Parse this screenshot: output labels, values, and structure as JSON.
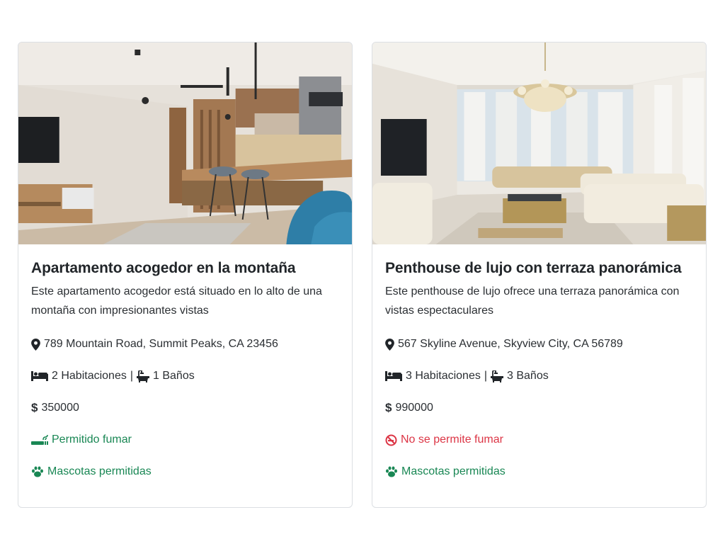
{
  "listings": [
    {
      "title": "Apartamento acogedor en la montaña",
      "description": "Este apartamento acogedor está situado en lo alto de una montaña con impresionantes vistas",
      "address": "789 Mountain Road, Summit Peaks, CA 23456",
      "bedrooms": "2 Habitaciones",
      "separator": "|",
      "bathrooms": "1 Baños",
      "price": "350000",
      "smoking": "Permitido fumar",
      "smoking_allowed": true,
      "pets": "Mascotas permitidas",
      "icons": [
        "map-marker-icon",
        "bed-icon",
        "bath-icon",
        "dollar-icon",
        "smoking-icon",
        "paw-icon"
      ]
    },
    {
      "title": "Penthouse de lujo con terraza panorámica",
      "description": "Este penthouse de lujo ofrece una terraza panorámica con vistas espectaculares",
      "address": "567 Skyline Avenue, Skyview City, CA 56789",
      "bedrooms": "3 Habitaciones",
      "separator": "|",
      "bathrooms": "3 Baños",
      "price": "990000",
      "smoking": "No se permite fumar",
      "smoking_allowed": false,
      "pets": "Mascotas permitidas",
      "icons": [
        "map-marker-icon",
        "bed-icon",
        "bath-icon",
        "dollar-icon",
        "ban-smoking-icon",
        "paw-icon"
      ]
    }
  ],
  "colors": {
    "allowed": "#198754",
    "forbidden": "#dc3545",
    "text": "#212529"
  }
}
